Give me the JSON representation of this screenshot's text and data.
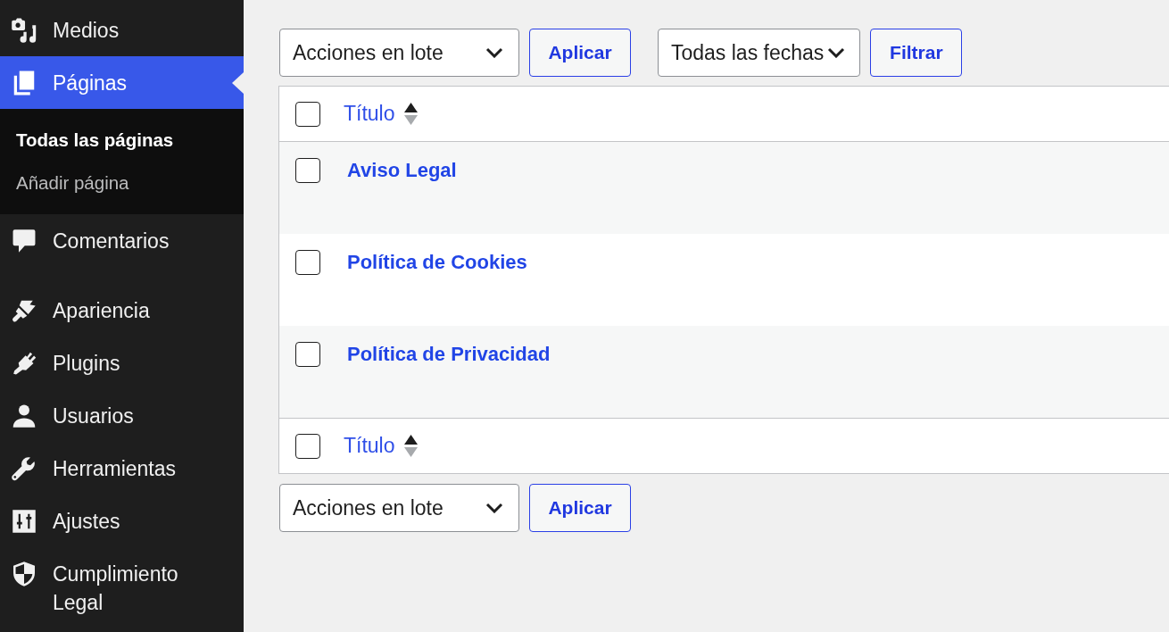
{
  "sidebar": {
    "groups": [
      {
        "items": [
          {
            "label": "Medios",
            "selected": false
          },
          {
            "label": "Páginas",
            "selected": true,
            "children": [
              {
                "label": "Todas las páginas",
                "selected": true
              },
              {
                "label": "Añadir página",
                "selected": false
              }
            ]
          },
          {
            "label": "Comentarios",
            "selected": false
          }
        ]
      },
      {
        "items": [
          {
            "label": "Apariencia",
            "selected": false
          },
          {
            "label": "Plugins",
            "selected": false
          },
          {
            "label": "Usuarios",
            "selected": false
          },
          {
            "label": "Herramientas",
            "selected": false
          },
          {
            "label": "Ajustes",
            "selected": false
          },
          {
            "label": "Cumplimiento Legal",
            "selected": false
          }
        ]
      }
    ]
  },
  "top_toolbar": {
    "bulk_actions": {
      "value": "Acciones en lote"
    },
    "apply_button": "Aplicar",
    "date_filter": {
      "value": "Todas las fechas"
    },
    "filter_button": "Filtrar"
  },
  "table": {
    "header": {
      "checked": false,
      "column": "Título",
      "sorted_ascending": true
    },
    "rows": [
      {
        "title": "Aviso Legal",
        "checked": false
      },
      {
        "title": "Política de Cookies",
        "checked": false
      },
      {
        "title": "Política de Privacidad",
        "checked": false
      }
    ],
    "footer": {
      "checked": false,
      "column": "Título",
      "sorted_ascending": true
    }
  },
  "bottom_toolbar": {
    "bulk_actions": {
      "value": "Acciones en lote"
    },
    "apply_button": "Aplicar"
  }
}
